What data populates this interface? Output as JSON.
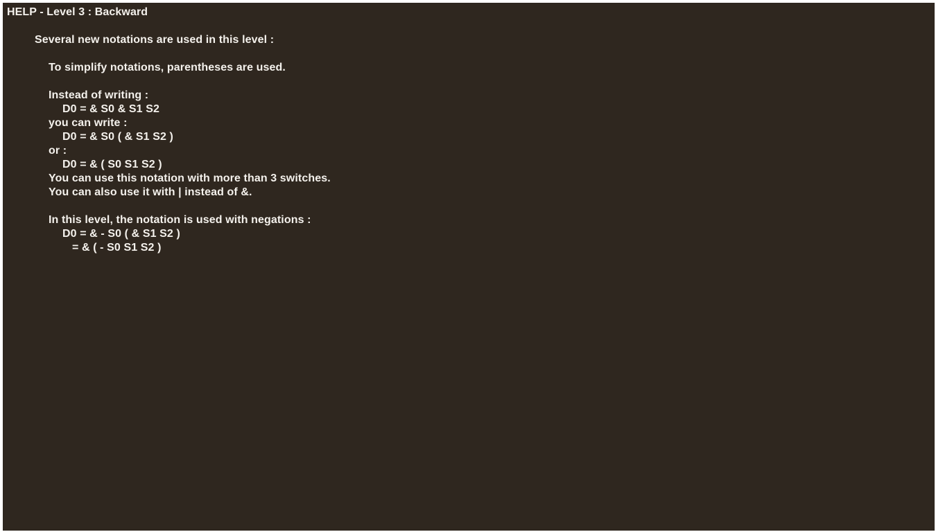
{
  "help": {
    "title": "HELP - Level 3 : Backward",
    "intro": "Several new notations are used in this level :",
    "parentheses_note": "To simplify notations, parentheses are used.",
    "instead_of_writing": "Instead of writing :",
    "formula_1": "D0 = & S0 & S1 S2",
    "you_can_write": "you can write :",
    "formula_2": "D0 = & S0 ( & S1 S2 )",
    "or": "or :",
    "formula_3": "D0 = & ( S0 S1 S2 )",
    "more_switches": "You can use this notation with more than 3 switches.",
    "also_or": "You can also use it with | instead of &.",
    "negations_note": "In this level, the notation is used with negations :",
    "formula_4": "D0 = & - S0 ( & S1 S2 )",
    "formula_5": "= & ( - S0 S1 S2 )"
  },
  "colors": {
    "background": "#2f271f",
    "text": "#f4f1ec"
  }
}
